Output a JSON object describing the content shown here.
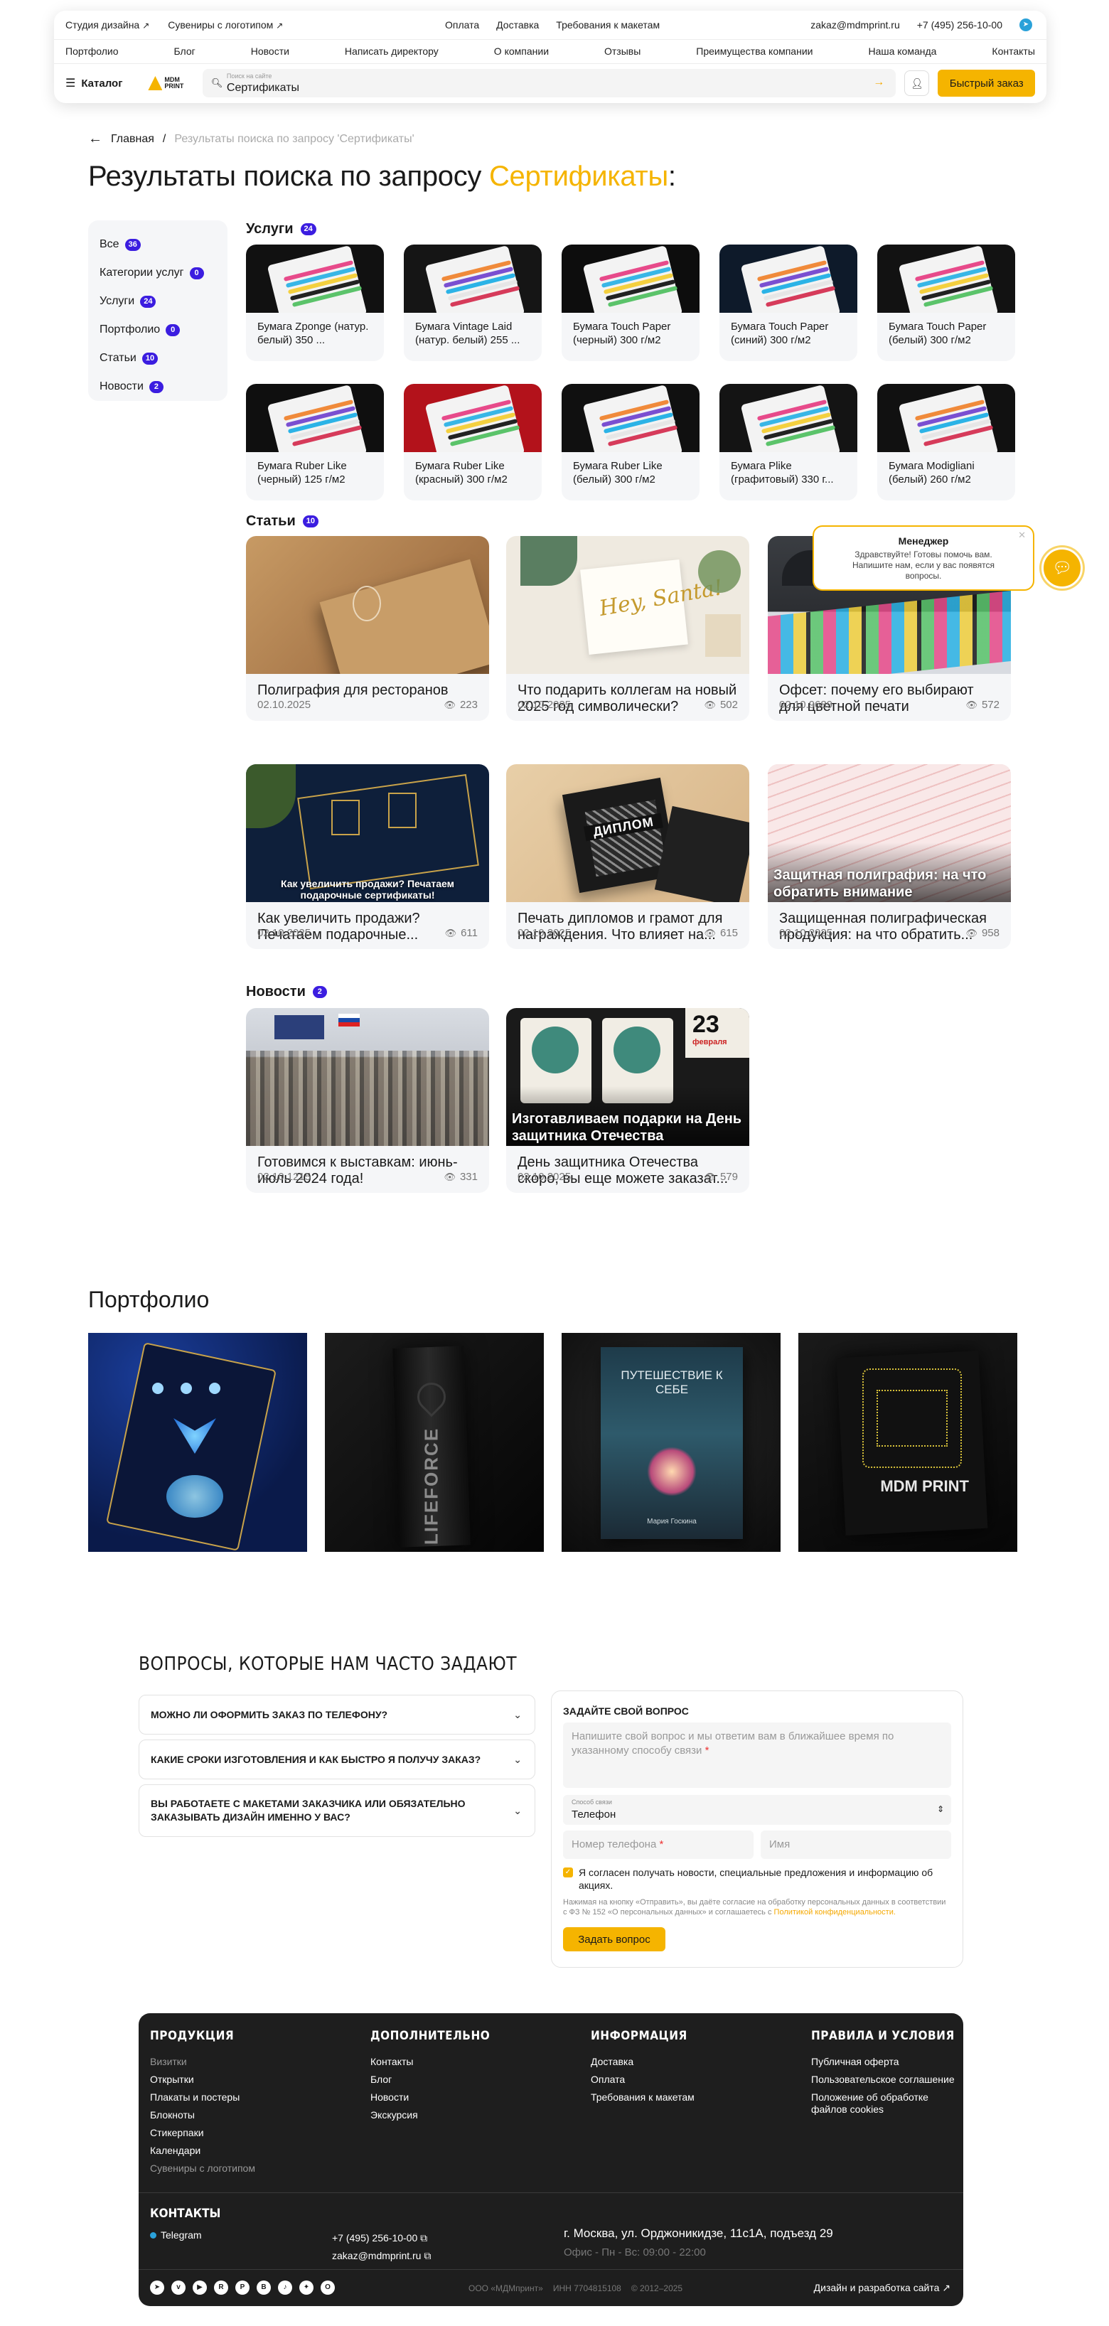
{
  "header": {
    "top_left": [
      "Студия дизайна",
      "Сувениры с логотипом"
    ],
    "top_center": [
      "Оплата",
      "Доставка",
      "Требования к макетам"
    ],
    "email": "zakaz@mdmprint.ru",
    "phone": "+7 (495) 256-10-00",
    "nav": [
      "Портфолио",
      "Блог",
      "Новости",
      "Написать директору",
      "О компании",
      "Отзывы",
      "Преимущества компании",
      "Наша команда",
      "Контакты"
    ],
    "catalog_label": "Каталог",
    "logo_text": [
      "MDM",
      "PRINT"
    ],
    "search_placeholder": "Поиск на сайте",
    "search_value": "Сертификаты",
    "fast_order": "Быстрый заказ"
  },
  "breadcrumb": {
    "home": "Главная",
    "current": "Результаты поиска по запросу 'Сертификаты'"
  },
  "title": {
    "prefix": "Результаты поиска по запросу",
    "query": "Сертификаты",
    "suffix": ":"
  },
  "filters": [
    {
      "label": "Все",
      "count": "36"
    },
    {
      "label": "Категории услуг",
      "count": "0"
    },
    {
      "label": "Услуги",
      "count": "24"
    },
    {
      "label": "Портфолио",
      "count": "0"
    },
    {
      "label": "Статьи",
      "count": "10"
    },
    {
      "label": "Новости",
      "count": "2"
    }
  ],
  "services": {
    "label": "Услуги",
    "count": "24",
    "items": [
      {
        "name": "Бумага Zponge (натур. белый) 350 ...",
        "bg": "#111111"
      },
      {
        "name": "Бумага Vintage Laid (натур. белый) 255 ...",
        "bg": "#151515"
      },
      {
        "name": "Бумага Touch Paper (черный) 300 г/м2",
        "bg": "#0d0d0d"
      },
      {
        "name": "Бумага Touch Paper (синий) 300 г/м2",
        "bg": "#0e1a2a"
      },
      {
        "name": "Бумага Touch Paper (белый) 300 г/м2",
        "bg": "#121212"
      },
      {
        "name": "Бумага Ruber Like (черный) 125 г/м2",
        "bg": "#0f0f0f"
      },
      {
        "name": "Бумага Ruber Like (красный) 300 г/м2",
        "bg": "#b3121b"
      },
      {
        "name": "Бумага Ruber Like (белый) 300 г/м2",
        "bg": "#101010"
      },
      {
        "name": "Бумага Plike (графитовый) 330 г...",
        "bg": "#141414"
      },
      {
        "name": "Бумага Modigliani (белый) 260 г/м2",
        "bg": "#111111"
      }
    ]
  },
  "articles": {
    "label": "Статьи",
    "count": "10",
    "items": [
      {
        "title": "Полиграфия для ресторанов",
        "date": "02.10.2025",
        "views": "223",
        "overlay": ""
      },
      {
        "title": "Что подарить коллегам на новый 2025 год символически?",
        "date": "02.10.2025",
        "views": "502",
        "overlay": ""
      },
      {
        "title": "Офсет: почему его выбирают для цветной печати",
        "date": "02.10.9689",
        "views": "572",
        "overlay": ""
      },
      {
        "title": "Как увеличить продажи? Печатаем подарочные...",
        "date": "02.10.2025",
        "views": "611",
        "overlay": "Как увеличить продажи? Печатаем подарочные сертификаты!"
      },
      {
        "title": "Печать дипломов и грамот для награждения. Что влияет на...",
        "date": "02.10.2025",
        "views": "615",
        "overlay": ""
      },
      {
        "title": "Защищенная полиграфическая продукция: на что обратить...",
        "date": "02.10.2025",
        "views": "958",
        "overlay": "Защитная полиграфия: на что обратить внимание"
      }
    ]
  },
  "news": {
    "label": "Новости",
    "count": "2",
    "items": [
      {
        "title": "Готовимся к выставкам: июнь-июль 2024 года!",
        "date": "02.10.1215",
        "views": "331",
        "overlay": ""
      },
      {
        "title": "День защитника Отечества скоро, вы еще можете заказат...",
        "date": "02.10.2025",
        "views": "579",
        "overlay": "Изготавливаем подарки на День защитника Отечества"
      }
    ]
  },
  "image_texts": {
    "santa": "Hey, Santa!",
    "diploma": "ДИПЛОМ",
    "feb": "23",
    "feb_word": "февраля",
    "book": "ПУТЕШЕСТВИЕ К СЕБЕ",
    "book_author": "Мария Госкина",
    "lifeforce": "LIFEFORCE",
    "mdm": "MDM PRINT"
  },
  "chat": {
    "title": "Менеджер",
    "text": "Здравствуйте! Готовы помочь вам. Напишите нам, если у вас появятся вопросы."
  },
  "portfolio": {
    "title": "Портфолио"
  },
  "faq": {
    "title": "ВОПРОСЫ, КОТОРЫЕ НАМ ЧАСТО ЗАДАЮТ",
    "questions": [
      "МОЖНО ЛИ ОФОРМИТЬ ЗАКАЗ ПО ТЕЛЕФОНУ?",
      "КАКИЕ СРОКИ ИЗГОТОВЛЕНИЯ И КАК БЫСТРО Я ПОЛУЧУ ЗАКАЗ?",
      "ВЫ РАБОТАЕТЕ С МАКЕТАМИ ЗАКАЗЧИКА ИЛИ ОБЯЗАТЕЛЬНО ЗАКАЗЫВАТЬ ДИЗАЙН ИМЕННО У ВАС?"
    ]
  },
  "ask": {
    "title": "ЗАДАЙТЕ СВОЙ ВОПРОС",
    "textarea_placeholder": "Напишите свой вопрос и мы ответим вам в ближайшее время по указанному способу связи",
    "contact_label": "Способ связи",
    "contact_value": "Телефон",
    "phone_placeholder": "Номер телефона",
    "name_placeholder": "Имя",
    "consent": "Я согласен получать новости, специальные предложения и информацию об акциях.",
    "legal": "Нажимая на кнопку «Отправить», вы даёте согласие на обработку персональных данных в соответствии с ФЗ № 152 «О персональных данных» и соглашаетесь с",
    "legal_link": "Политикой конфиденциальности.",
    "submit": "Задать вопрос"
  },
  "footer": {
    "cols": [
      {
        "title": "ПРОДУКЦИЯ",
        "items": [
          "Визитки",
          "Открытки",
          "Плакаты и постеры",
          "Блокноты",
          "Стикерпаки",
          "Календари",
          "Сувениры с логотипом"
        ]
      },
      {
        "title": "ДОПОЛНИТЕЛЬНО",
        "items": [
          "Контакты",
          "Блог",
          "Новости",
          "Экскурсия"
        ]
      },
      {
        "title": "ИНФОРМАЦИЯ",
        "items": [
          "Доставка",
          "Оплата",
          "Требования к макетам"
        ]
      },
      {
        "title": "ПРАВИЛА И УСЛОВИЯ",
        "items": [
          "Публичная оферта",
          "Пользовательское соглашение",
          "Положение об обработке файлов cookies"
        ]
      }
    ],
    "contacts_title": "КОНТАКТЫ",
    "telegram": "Telegram",
    "phone": "+7 (495) 256-10-00",
    "email": "zakaz@mdmprint.ru",
    "address": "г. Москва, ул. Орджоникидзе, 11с1А, подъезд 29",
    "hours": "Офис - Пн - Вс: 09:00 - 22:00",
    "company": "ООО «МДМпринт»",
    "inn": "ИНН 7704815108",
    "years": "© 2012–2025",
    "dev": "Дизайн и разработка сайта"
  },
  "colors": {
    "accent": "#f5b400",
    "badge": "#3b1de0",
    "footer_bg": "#1e1e1e"
  }
}
